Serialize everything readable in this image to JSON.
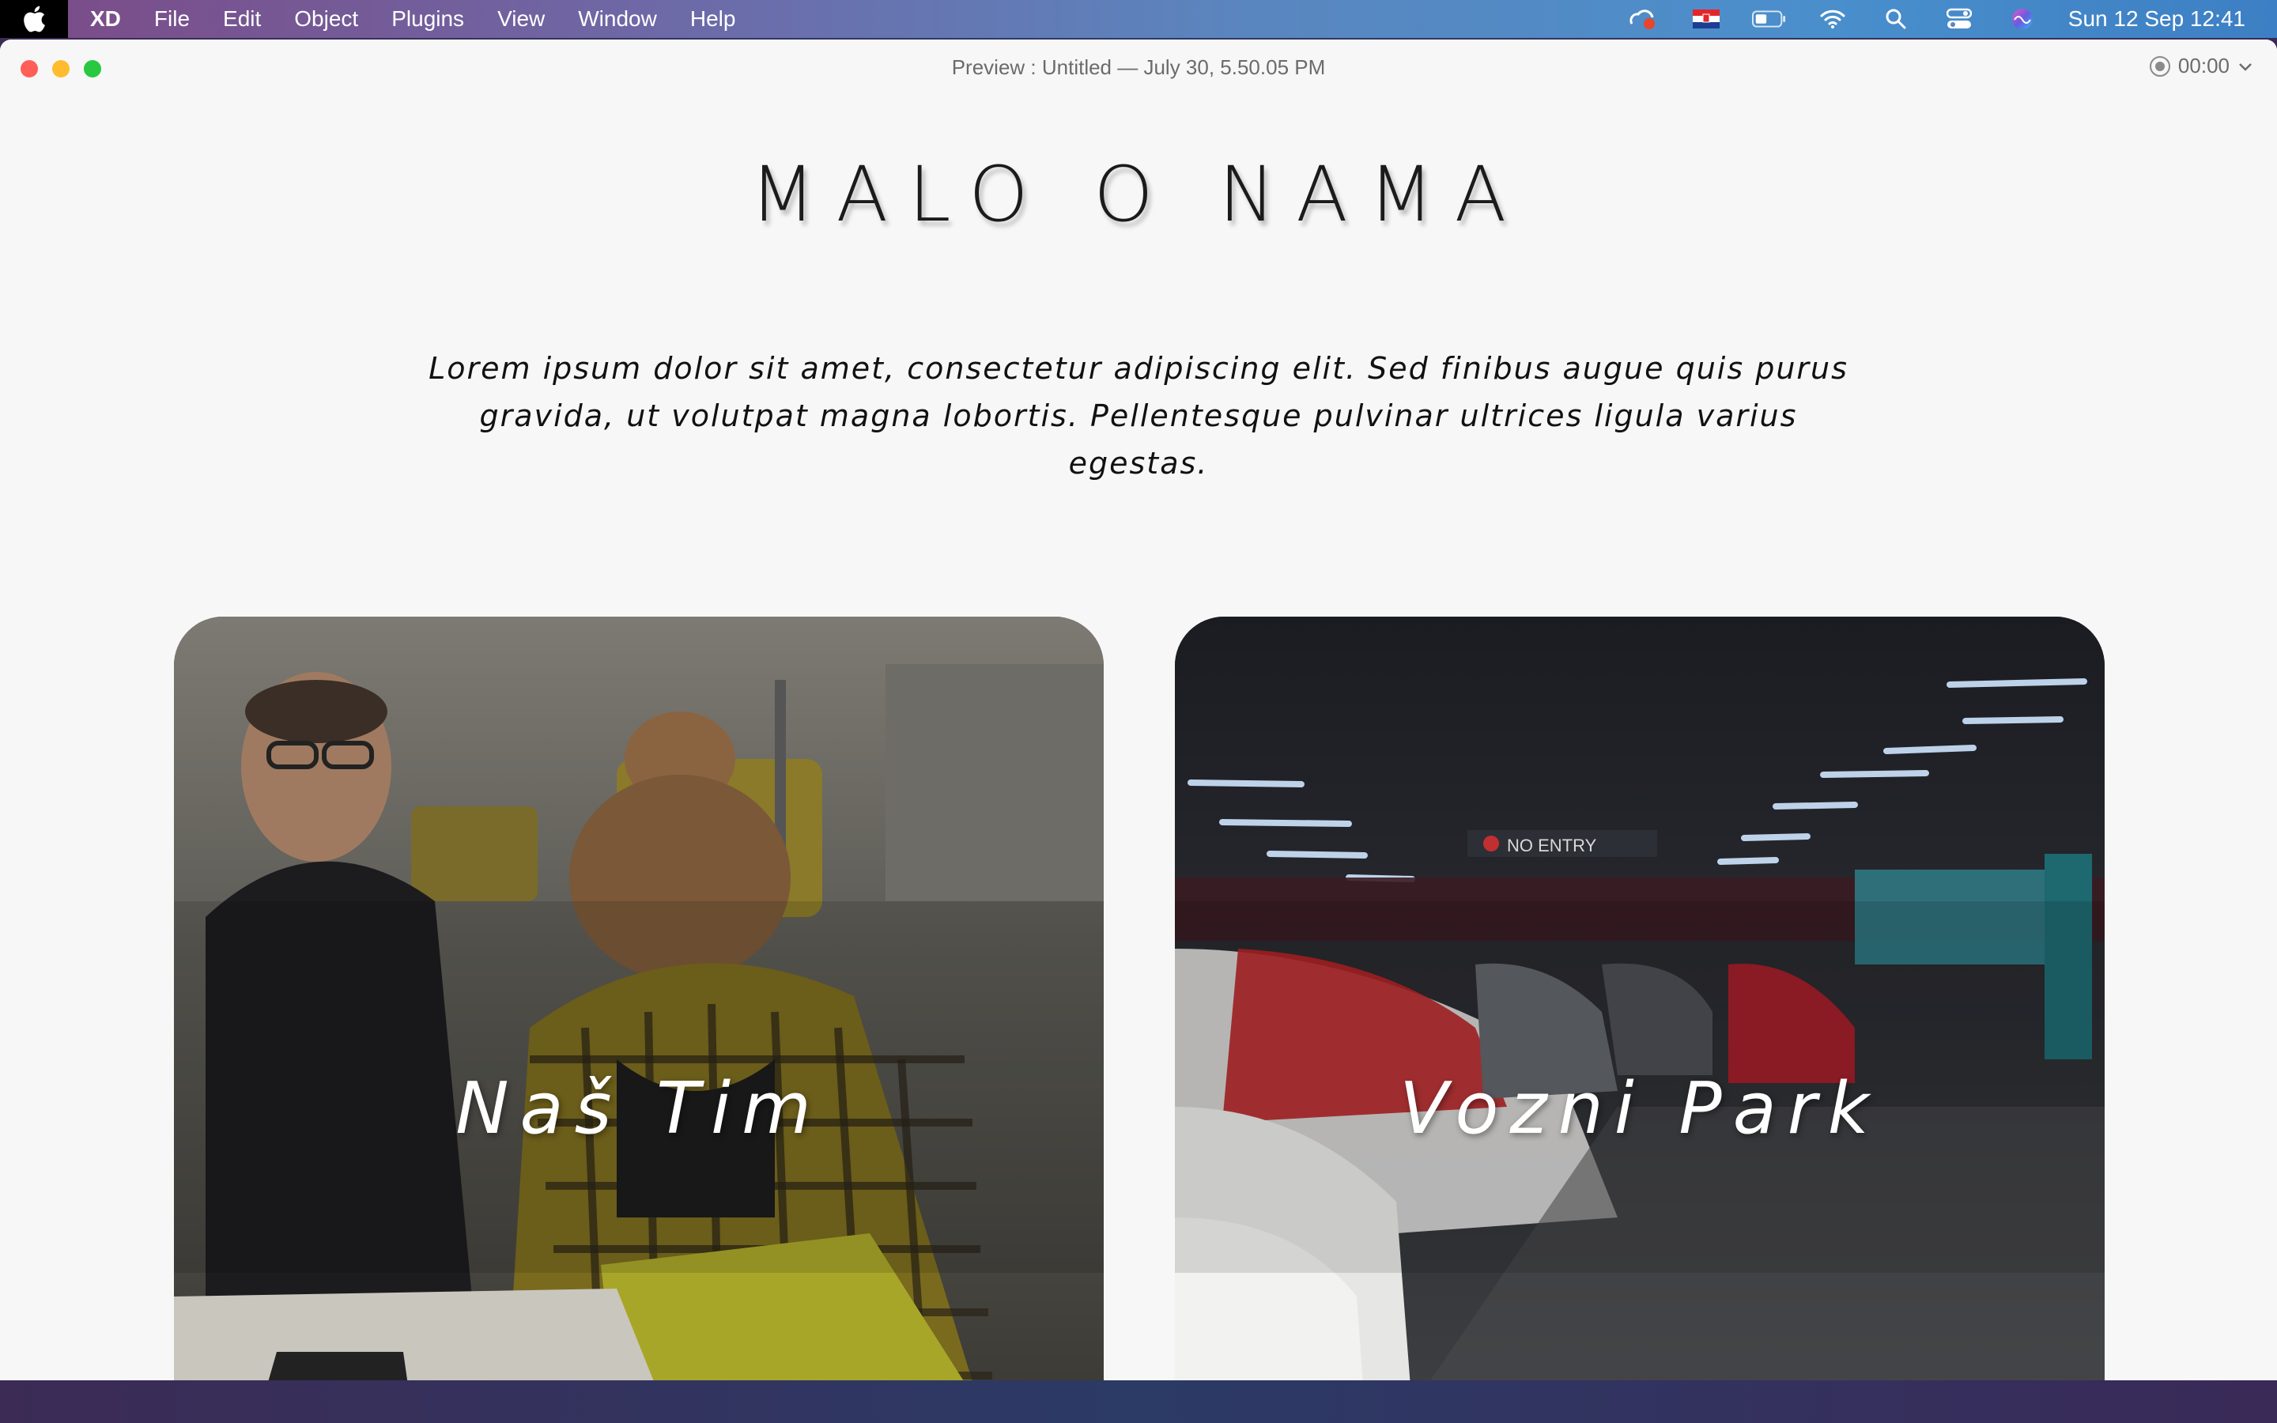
{
  "menubar": {
    "app_name": "XD",
    "items": [
      "File",
      "Edit",
      "Object",
      "Plugins",
      "View",
      "Window",
      "Help"
    ],
    "clock": "Sun 12 Sep  12:41"
  },
  "window": {
    "title": "Preview : Untitled — July 30, 5.50.05 PM",
    "timer": "00:00"
  },
  "page": {
    "heading": "MALO O NAMA",
    "intro": "Lorem ipsum dolor sit amet, consectetur adipiscing elit. Sed finibus augue quis purus gravida, ut volutpat magna lobortis. Pellentesque pulvinar ultrices ligula varius egestas.",
    "cards": [
      {
        "label": "Naš Tim"
      },
      {
        "label": "Vozni Park",
        "sign_text": "NO ENTRY"
      }
    ]
  },
  "colors": {
    "close": "#ff5f57",
    "minimize": "#febc2e",
    "maximize": "#28c840",
    "window_bg": "#f7f7f7"
  }
}
